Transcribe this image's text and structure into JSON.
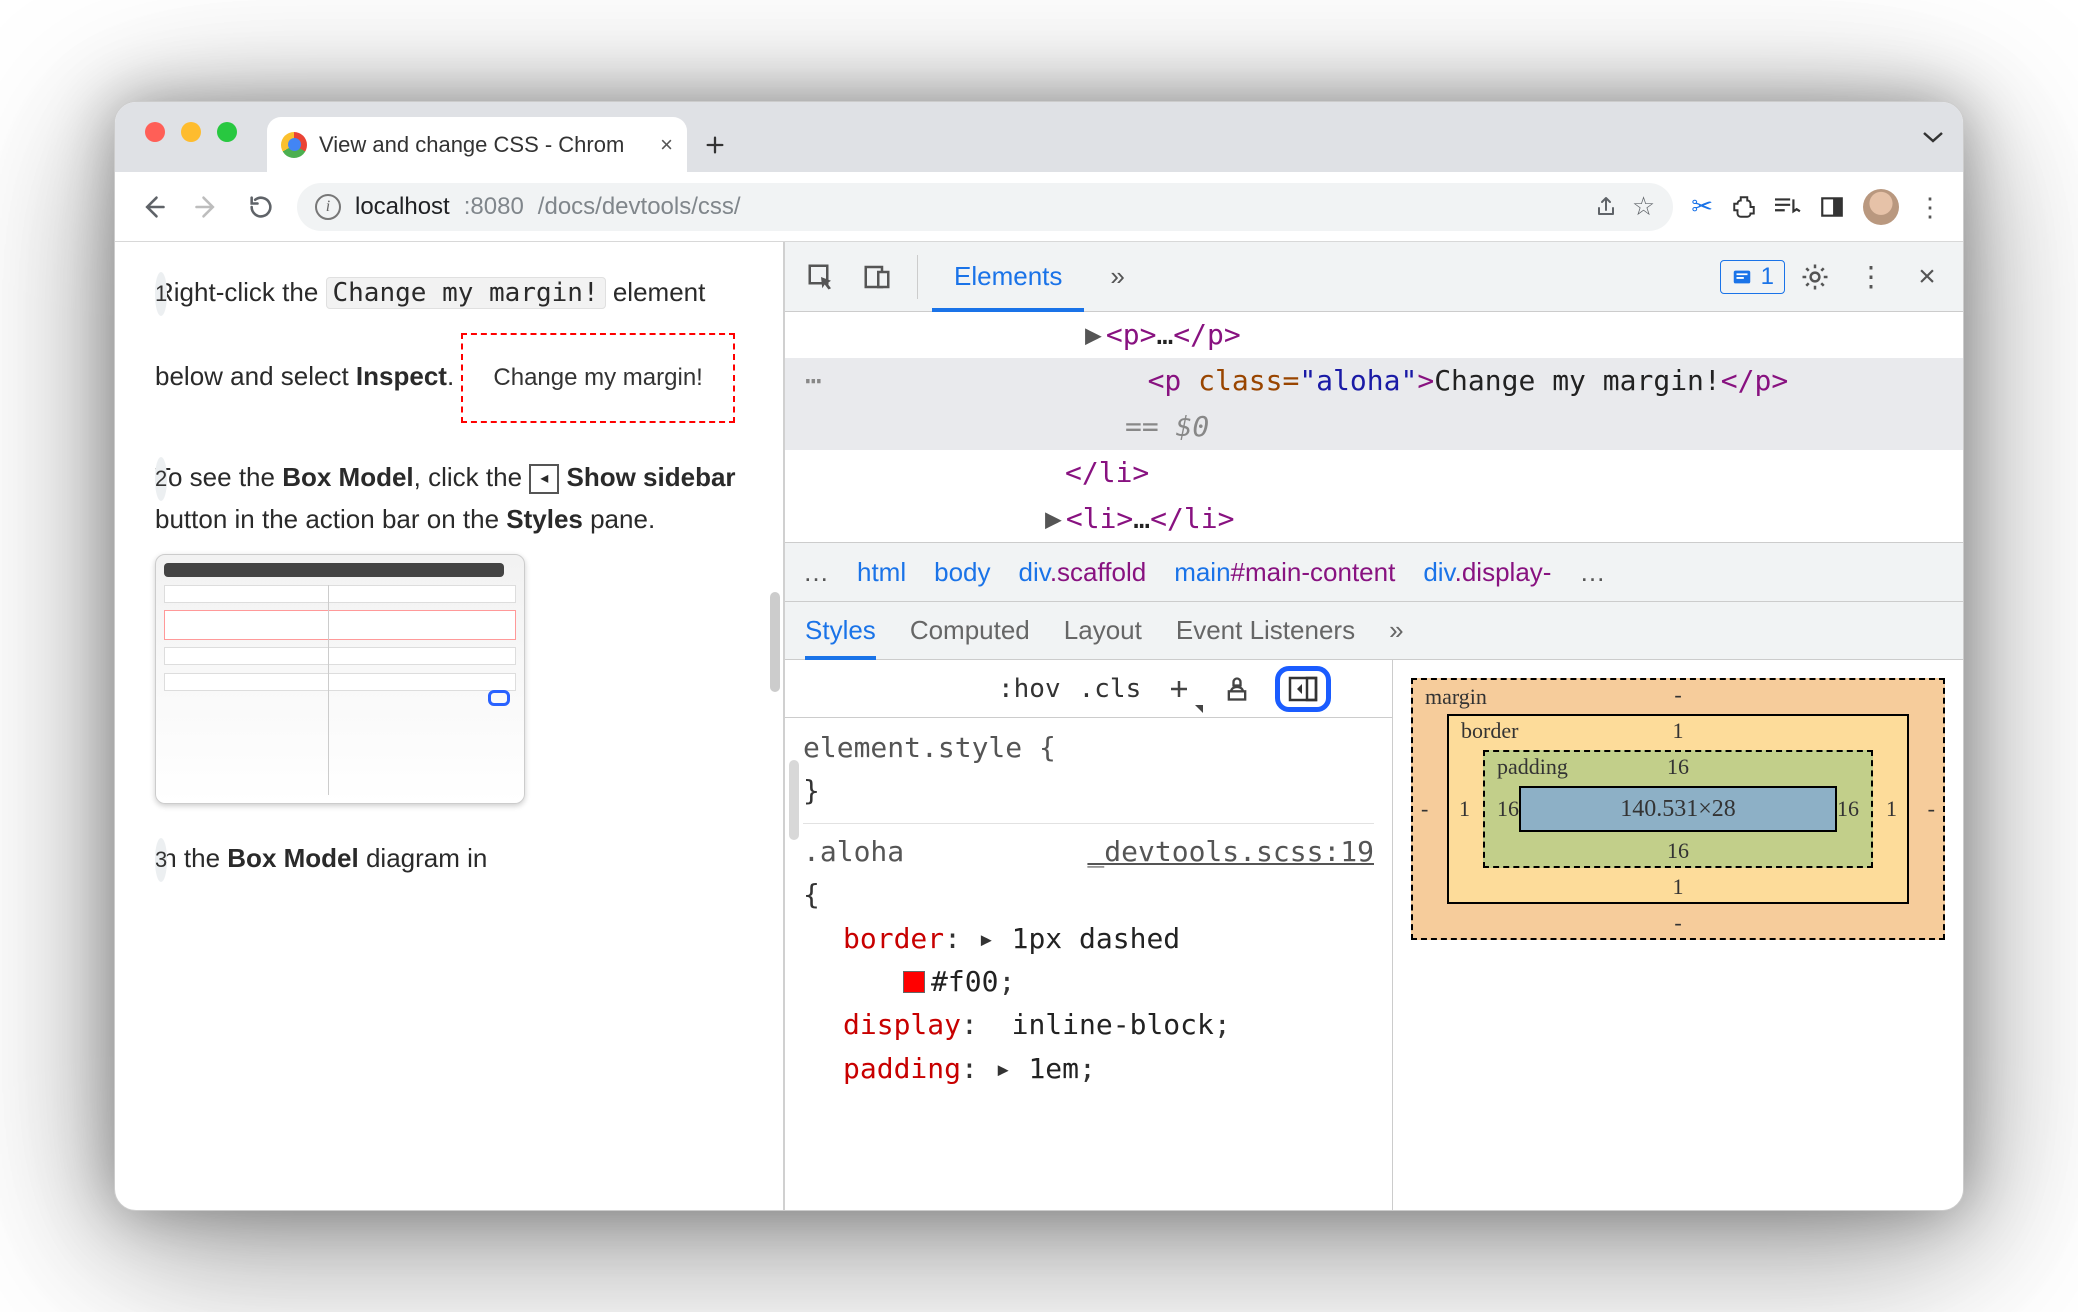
{
  "tab": {
    "title": "View and change CSS - Chrom"
  },
  "url": {
    "host": "localhost",
    "port": ":8080",
    "path": "/docs/devtools/css/"
  },
  "devtools_header": {
    "elements": "Elements",
    "more": "»",
    "issues": "1"
  },
  "dom": {
    "l1": "<p>…</p>",
    "sel_open": "<p ",
    "sel_class_attr": "class=",
    "sel_class_val": "\"aloha\"",
    "sel_close_open": ">",
    "sel_text": "Change my margin!",
    "sel_close": "</p>",
    "eq": "== $0",
    "l3": "</li>",
    "l4": "<li>…</li>"
  },
  "crumb": {
    "ell": "…",
    "html": "html",
    "body": "body",
    "div_pre": "div",
    "scaffold": ".scaffold",
    "main_pre": "main",
    "main_id": "#main-content",
    "div2_pre": "div",
    "display": ".display-",
    "end": "…"
  },
  "subtabs": {
    "styles": "Styles",
    "computed": "Computed",
    "layout": "Layout",
    "events": "Event Listeners",
    "more": "»"
  },
  "styles_bar": {
    "hov": ":hov",
    "cls": ".cls"
  },
  "css": {
    "element_style": "element.style {",
    "close": "}",
    "aloha_sel": ".aloha",
    "aloha_src": "_devtools.scss:19",
    "open": "{",
    "border_p": "border",
    "border_v": "1px dashed",
    "border_hex": "#f00",
    "display_p": "display",
    "display_v": "inline-block",
    "padding_p": "padding",
    "padding_v": "1em"
  },
  "box": {
    "margin": "margin",
    "border": "border",
    "padding": "padding",
    "content": "140.531×28",
    "m_top": "-",
    "m_right": "-",
    "m_bottom": "-",
    "m_left": "-",
    "b_top": "1",
    "b_right": "1",
    "b_bottom": "1",
    "b_left": "1",
    "p_top": "16",
    "p_right": "16",
    "p_bottom": "16",
    "p_left": "16"
  },
  "page": {
    "s1a": "Right-click the ",
    "s1code": "Change my margin!",
    "s1b": " element below and select ",
    "s1bold": "Inspect",
    "s1c": ".",
    "demo": "Change my margin!",
    "s2a": "To see the ",
    "s2bold1": "Box Model",
    "s2b": ", click the ",
    "s2bold2": "Show sidebar",
    "s2c": " button in the action bar on the ",
    "s2bold3": "Styles",
    "s2d": " pane.",
    "s3a": "In the ",
    "s3bold": "Box Model",
    "s3b": " diagram in"
  }
}
